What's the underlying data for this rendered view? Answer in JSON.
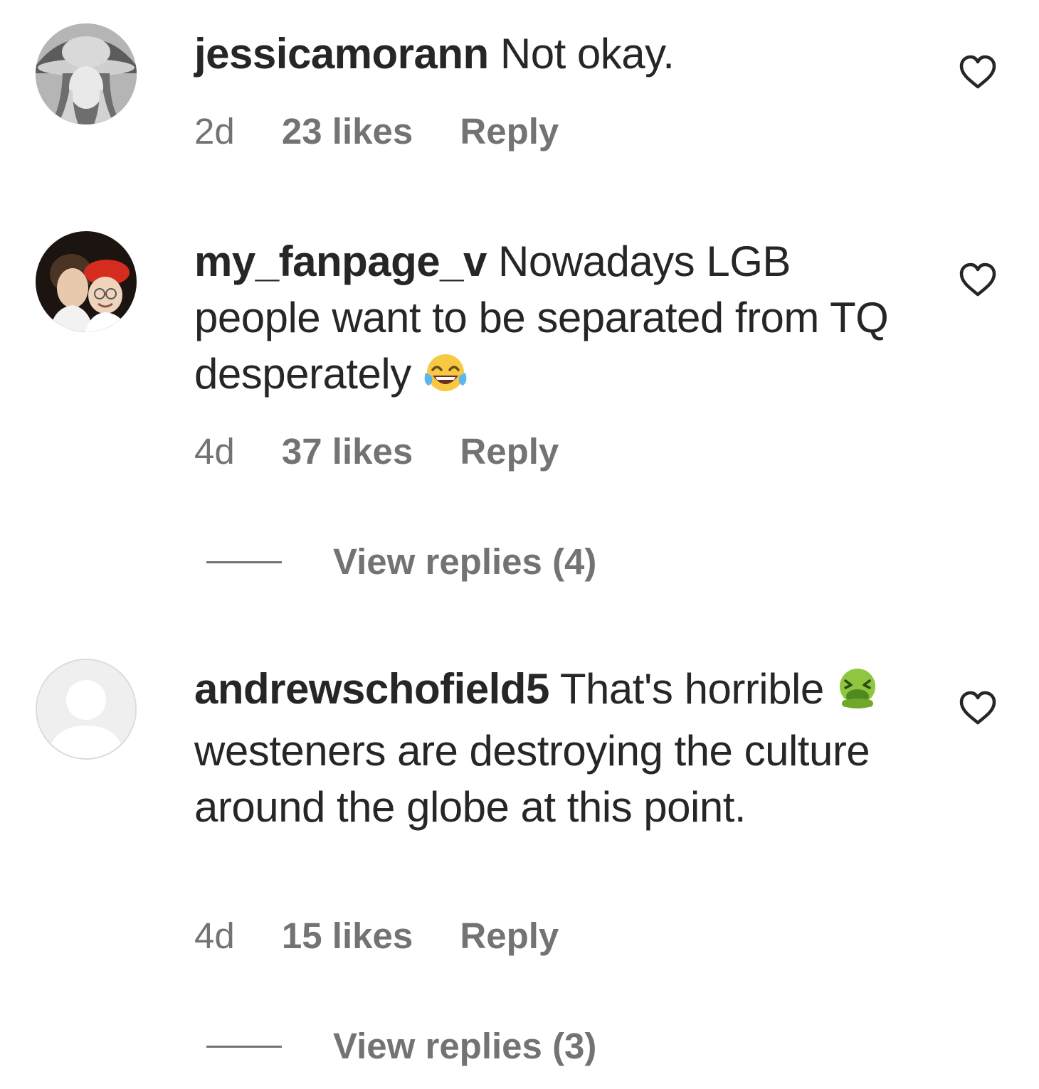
{
  "comments": [
    {
      "username": "jessicamorann",
      "text": "Not okay.",
      "emoji": "",
      "text_after_emoji": "",
      "time": "2d",
      "likes": "23 likes",
      "reply": "Reply"
    },
    {
      "username": "my_fanpage_v",
      "text": "Nowadays LGB people want to be separated from TQ desperately",
      "emoji": "face-with-tears-of-joy",
      "text_after_emoji": "",
      "time": "4d",
      "likes": "37 likes",
      "reply": "Reply",
      "view_replies": "View replies (4)"
    },
    {
      "username": "andrewschofield5",
      "text": "That's horrible",
      "emoji": "nauseated-face",
      "text_after_emoji": "westeners are destroying the culture around the globe at this point.",
      "time": "4d",
      "likes": "15 likes",
      "reply": "Reply",
      "view_replies": "View replies (3)"
    }
  ],
  "icons": {
    "like": "heart-outline-icon",
    "default_avatar": "default-avatar-icon"
  },
  "colors": {
    "text": "#262626",
    "secondary": "#737373",
    "background": "#ffffff"
  }
}
